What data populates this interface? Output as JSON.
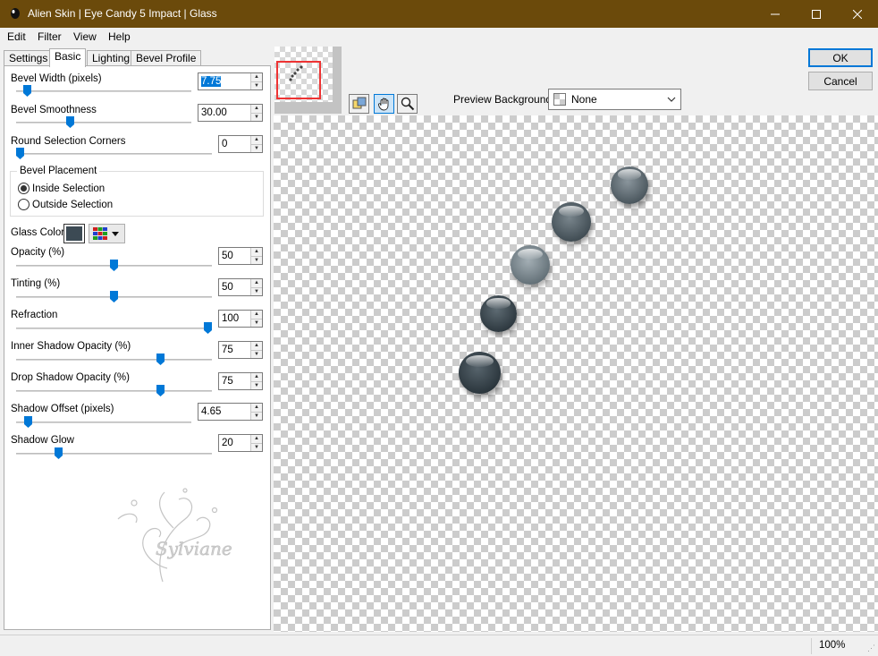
{
  "window": {
    "title": "Alien Skin | Eye Candy 5 Impact | Glass",
    "controls": {
      "minimize": "—",
      "maximize": "☐",
      "close": "✕"
    }
  },
  "menu": [
    "Edit",
    "Filter",
    "View",
    "Help"
  ],
  "tabs": [
    "Settings",
    "Basic",
    "Lighting",
    "Bevel Profile"
  ],
  "active_tab": "Basic",
  "controls": {
    "bevel_width": {
      "label": "Bevel Width (pixels)",
      "value": "7.75"
    },
    "bevel_smoothness": {
      "label": "Bevel Smoothness",
      "value": "30.00"
    },
    "round_corners": {
      "label": "Round Selection Corners",
      "value": "0"
    },
    "bevel_placement": {
      "label": "Bevel Placement",
      "options": [
        "Inside Selection",
        "Outside Selection"
      ],
      "selected": "Inside Selection"
    },
    "glass_color": {
      "label": "Glass Color",
      "color": "#3c4a54"
    },
    "opacity": {
      "label": "Opacity (%)",
      "value": "50"
    },
    "tinting": {
      "label": "Tinting (%)",
      "value": "50"
    },
    "refraction": {
      "label": "Refraction",
      "value": "100"
    },
    "inner_shadow": {
      "label": "Inner Shadow Opacity (%)",
      "value": "75"
    },
    "drop_shadow": {
      "label": "Drop Shadow Opacity (%)",
      "value": "75"
    },
    "shadow_offset": {
      "label": "Shadow Offset (pixels)",
      "value": "4.65"
    },
    "shadow_glow": {
      "label": "Shadow Glow",
      "value": "20"
    }
  },
  "watermark": "Sylviane",
  "preview": {
    "background_label": "Preview Background:",
    "background_value": "None",
    "tools": [
      "preview-toggle-icon",
      "hand-icon",
      "zoom-icon"
    ]
  },
  "buttons": {
    "ok": "OK",
    "cancel": "Cancel"
  },
  "status": {
    "zoom": "100%"
  },
  "colors": {
    "titlebar": "#6b4a0b",
    "accent": "#0078d7",
    "glass": "#3c4a54"
  }
}
